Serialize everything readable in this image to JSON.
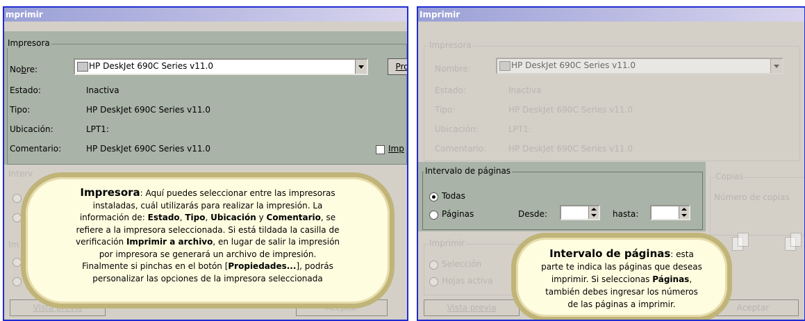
{
  "left": {
    "title": "mprimir",
    "group_printer": "Impresora",
    "name_label": "Nombre:",
    "name_label_ul": "b",
    "printer_value": "HP DeskJet 690C Series v11.0",
    "props_button": "Pro",
    "estado_label": "Estado:",
    "estado_value": "Inactiva",
    "tipo_label": "Tipo:",
    "tipo_value": "HP DeskJet 690C Series v11.0",
    "ubic_label": "Ubicación:",
    "ubic_value": "LPT1:",
    "coment_label": "Comentario:",
    "coment_value": "HP DeskJet 690C Series v11.0",
    "print_to_file": "Imp",
    "faded_interval": "Interv",
    "faded_imprimir": "Im",
    "preview_button": "Vista previa",
    "accept_button": "Aceptar",
    "bubble": {
      "line1_bold": "Impresora",
      "line1_rest": ": Aquí puedes seleccionar entre las impresoras",
      "line2": "instaladas, cuál utilizarás para realizar la impresión. La",
      "line3_a": "información de: ",
      "line3_b1": "Estado",
      "line3_c": ", ",
      "line3_b2": "Tipo",
      "line3_d": ", ",
      "line3_b3": "Ubicación",
      "line3_e": " y ",
      "line3_b4": "Comentario",
      "line3_f": ", se",
      "line4": "refiere a la impresora seleccionada. Si está tildada la casilla de",
      "line5_a": "verificación ",
      "line5_b": "Imprimir a archivo",
      "line5_c": ", en lugar de salir la impresión",
      "line6": "por impresora se generará un archivo de impresión.",
      "line7_a": "Finalmente si pinchas en el botón [",
      "line7_b": "Propiedades...",
      "line7_c": "], podrás",
      "line8": "personalizar las opciones de la impresora seleccionada"
    }
  },
  "right": {
    "title": "Imprimir",
    "group_printer": "Impresora",
    "name_label": "Nombre:",
    "printer_value": "HP DeskJet 690C Series v11.0",
    "estado_label": "Estado:",
    "estado_value": "Inactiva",
    "tipo_label": "Tipo:",
    "tipo_value": "HP DeskJet 690C Series v11.0",
    "ubic_label": "Ubicación:",
    "ubic_value": "LPT1:",
    "coment_label": "Comentario:",
    "coment_value": "HP DeskJet 690C Series v11.0",
    "group_interval": "Intervalo de páginas",
    "todas": "Todas",
    "paginas": "Páginas",
    "desde": "Desde:",
    "hasta": "hasta:",
    "group_copias": "Copias",
    "num_copias": "Número de copias",
    "group_imprimir": "Imprimir",
    "seleccion": "Selección",
    "hojas": "Hojas activa",
    "preview_button": "Vista previa",
    "accept_button": "Aceptar",
    "bubble": {
      "head": "Intervalo de páginas",
      "line1_rest": ": esta",
      "line2": "parte te indica las páginas que deseas",
      "line3_a": "imprimir. Si seleccionas ",
      "line3_b": "Páginas",
      "line3_c": ",",
      "line4": "también debes ingresar los números",
      "line5": "de las páginas a imprimir."
    }
  }
}
